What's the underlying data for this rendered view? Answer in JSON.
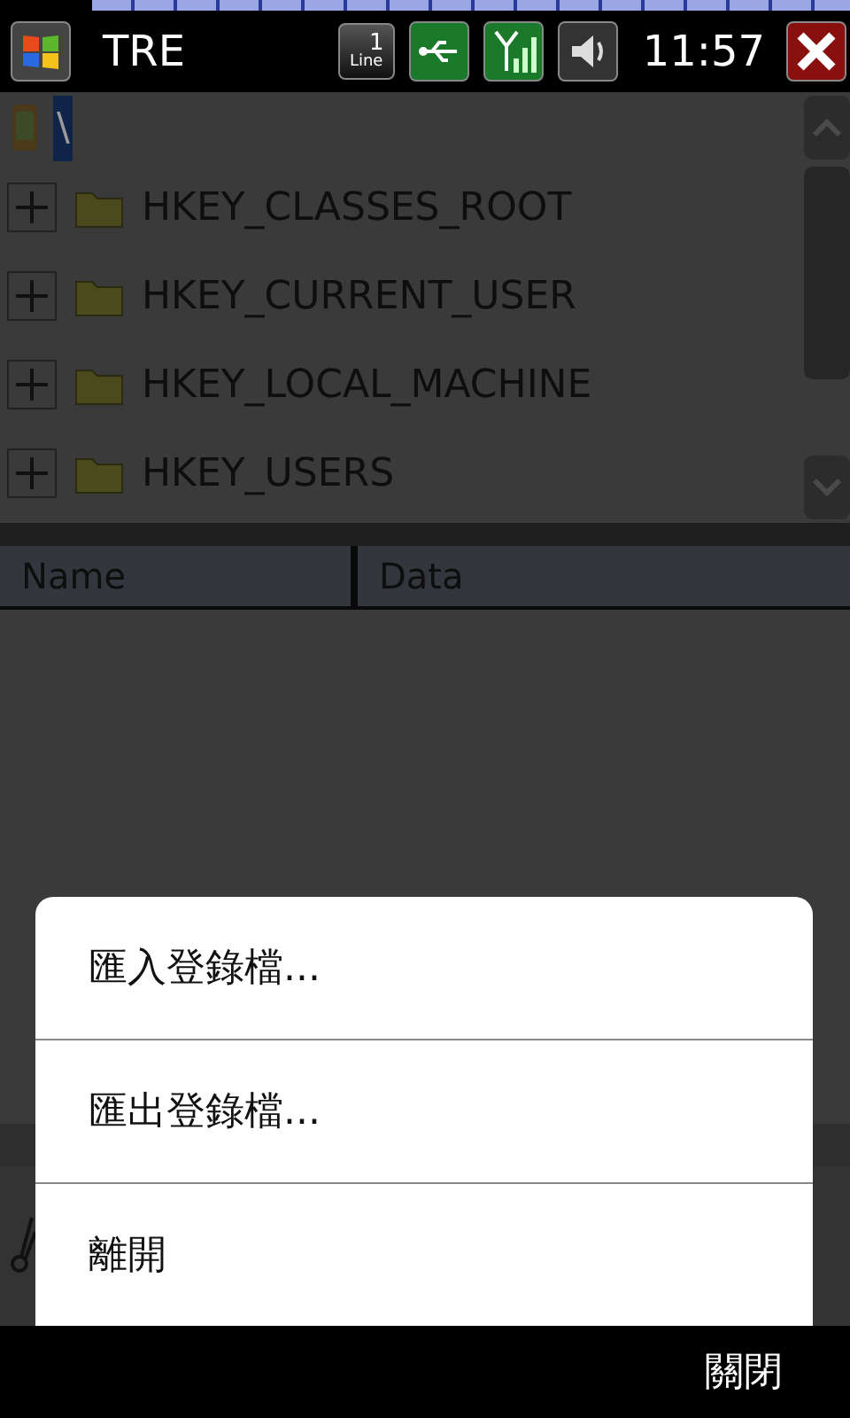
{
  "status_bar": {
    "title": "TRE",
    "line_badge": {
      "number": "1",
      "label": "Line"
    },
    "time": "11:57"
  },
  "tree": {
    "root": {
      "label": "\\",
      "selected": true
    },
    "items": [
      {
        "label": "HKEY_CLASSES_ROOT",
        "expanded": false
      },
      {
        "label": "HKEY_CURRENT_USER",
        "expanded": false
      },
      {
        "label": "HKEY_LOCAL_MACHINE",
        "expanded": false
      },
      {
        "label": "HKEY_USERS",
        "expanded": false
      }
    ]
  },
  "list_header": {
    "columns": [
      "Name",
      "Data"
    ]
  },
  "menu": {
    "items": [
      "匯入登錄檔...",
      "匯出登錄檔...",
      "離開"
    ]
  },
  "softkeys": {
    "right": "關閉"
  }
}
